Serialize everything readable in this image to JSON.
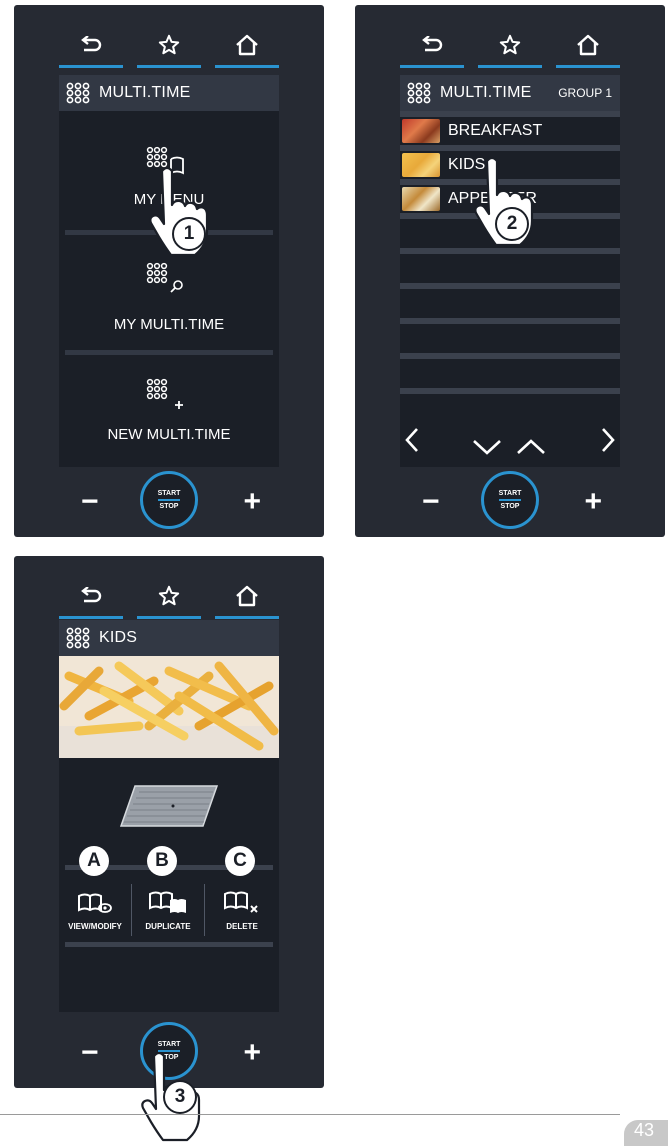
{
  "panel1": {
    "header_title": "MULTI.TIME",
    "menu": [
      {
        "label": "MY MENU"
      },
      {
        "label": "MY MULTI.TIME"
      },
      {
        "label": "NEW MULTI.TIME"
      }
    ],
    "step": "1"
  },
  "panel2": {
    "header_title": "MULTI.TIME",
    "group_label": "GROUP 1",
    "items": [
      {
        "label": "BREAKFAST"
      },
      {
        "label": "KIDS"
      },
      {
        "label": "APPETIZER"
      }
    ],
    "step": "2"
  },
  "panel3": {
    "header_title": "KIDS",
    "actions": [
      {
        "letter": "A",
        "label": "VIEW/MODIFY"
      },
      {
        "letter": "B",
        "label": "DUPLICATE"
      },
      {
        "letter": "C",
        "label": "DELETE"
      }
    ],
    "step": "3"
  },
  "controls": {
    "start_label": "START",
    "stop_label": "STOP",
    "minus": "−",
    "plus": "+"
  },
  "page_number": "43",
  "colors": {
    "accent": "#2a93d0",
    "panel_bg": "#262a33",
    "screen_bg": "#1b1f27",
    "header_bg": "#323844"
  }
}
